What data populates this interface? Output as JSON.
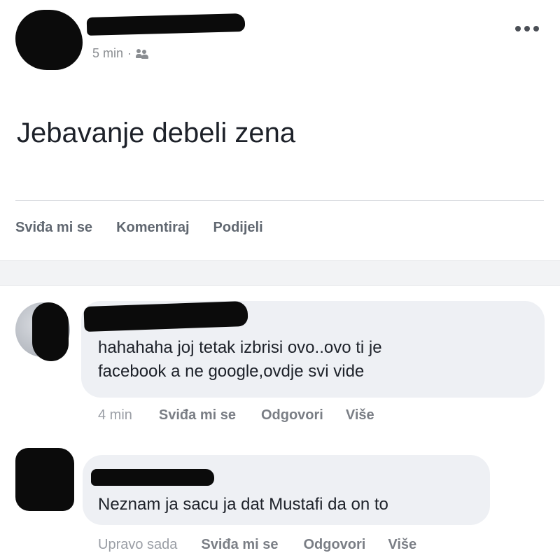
{
  "post": {
    "time": "5 min",
    "separator": "·",
    "audience_icon": "friends-icon",
    "text": "Jebavanje debeli zena",
    "menu_icon": "more-options-icon",
    "actions": {
      "like": "Sviđa mi se",
      "comment": "Komentiraj",
      "share": "Podijeli"
    }
  },
  "comments": [
    {
      "text_line1": "hahahaha joj tetak izbrisi ovo..ovo ti je",
      "text_line2": "facebook a ne google,ovdje svi vide",
      "time": "4 min",
      "like": "Sviđa mi se",
      "reply": "Odgovori",
      "more": "Više"
    },
    {
      "text_line1": "Neznam ja sacu ja dat Mustafi da on to",
      "time": "Upravo sada",
      "like": "Sviđa mi se",
      "reply": "Odgovori",
      "more": "Više"
    }
  ],
  "colors": {
    "background": "#ffffff",
    "bubble": "#eef0f4",
    "muted_text": "#8a8d91",
    "redaction": "#0b0b0b"
  }
}
